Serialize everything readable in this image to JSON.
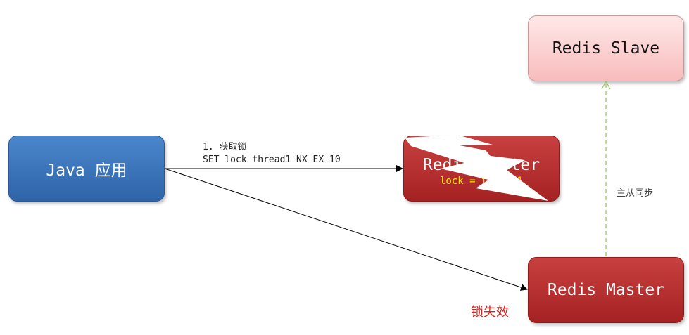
{
  "nodes": {
    "java_app": {
      "label": "Java 应用"
    },
    "redis_master_crashed": {
      "label": "Redis Master",
      "lock_value": "lock = thread1"
    },
    "redis_slave": {
      "label": "Redis Slave"
    },
    "redis_master_new": {
      "label": "Redis Master"
    }
  },
  "edges": {
    "acquire_lock": {
      "step": "1. 获取锁",
      "command": "SET lock thread1 NX EX 10"
    },
    "sync": {
      "label": "主从同步"
    }
  },
  "annotations": {
    "lock_lost": "锁失效"
  },
  "colors": {
    "java_box": "#3a74bb",
    "master_box": "#b52f2f",
    "slave_box": "#fbd0d0",
    "lock_text": "#ffe600",
    "lock_lost_text": "#e0201a",
    "sync_arrow": "#8fc45a"
  },
  "icons": {
    "crash": "lightning-bolt-icon"
  }
}
